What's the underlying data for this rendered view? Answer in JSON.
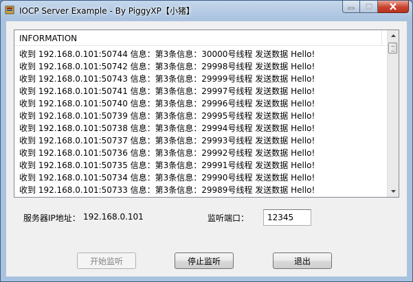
{
  "window": {
    "title": "IOCP Server Example - By PiggyXP【小猪】",
    "colors": {
      "frame": "#a9c2df",
      "close_button": "#c9432e"
    }
  },
  "log_list": {
    "header": "INFORMATION",
    "rows": [
      "收到  192.168.0.101:50744 信息：第3条信息：30000号线程 发送数据 Hello!",
      "收到  192.168.0.101:50742 信息：第3条信息：29998号线程 发送数据 Hello!",
      "收到  192.168.0.101:50743 信息：第3条信息：29999号线程 发送数据 Hello!",
      "收到  192.168.0.101:50741 信息：第3条信息：29997号线程 发送数据 Hello!",
      "收到  192.168.0.101:50740 信息：第3条信息：29996号线程 发送数据 Hello!",
      "收到  192.168.0.101:50739 信息：第3条信息：29995号线程 发送数据 Hello!",
      "收到  192.168.0.101:50738 信息：第3条信息：29994号线程 发送数据 Hello!",
      "收到  192.168.0.101:50737 信息：第3条信息：29993号线程 发送数据 Hello!",
      "收到  192.168.0.101:50736 信息：第3条信息：29992号线程 发送数据 Hello!",
      "收到  192.168.0.101:50735 信息：第3条信息：29991号线程 发送数据 Hello!",
      "收到  192.168.0.101:50734 信息：第3条信息：29990号线程 发送数据 Hello!",
      "收到  192.168.0.101:50733 信息：第3条信息：29989号线程 发送数据 Hello!"
    ]
  },
  "server_info": {
    "ip_label": "服务器IP地址：",
    "ip_value": "192.168.0.101",
    "port_label": "监听端口：",
    "port_value": "12345"
  },
  "buttons": {
    "start": "开始监听",
    "stop": "停止监听",
    "exit": "退出"
  },
  "icons": [
    "app-icon",
    "minimize-icon",
    "maximize-icon",
    "close-icon",
    "scroll-up-arrow-icon",
    "scroll-down-arrow-icon"
  ]
}
